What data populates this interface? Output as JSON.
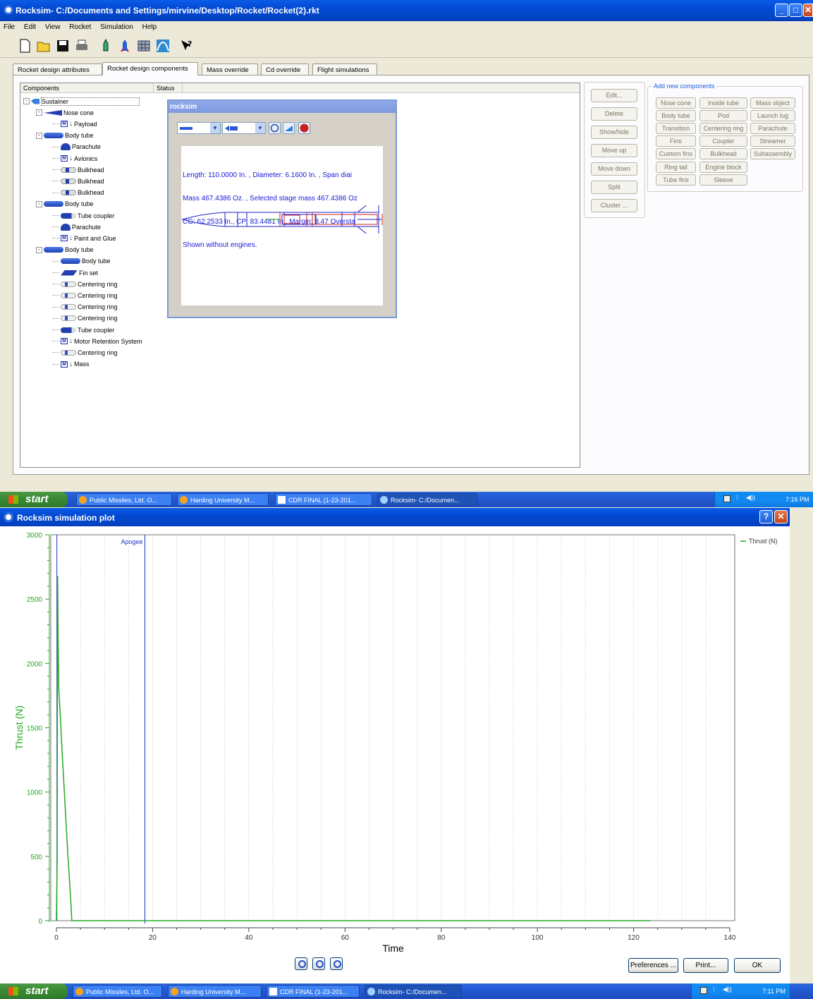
{
  "window_main": {
    "title": "Rocksim- C:/Documents and Settings/mirvine/Desktop/Rocket/Rocket(2).rkt",
    "menu": [
      "File",
      "Edit",
      "View",
      "Rocket",
      "Simulation",
      "Help"
    ],
    "tabs": [
      "Rocket design attributes",
      "Rocket design components",
      "Mass override",
      "Cd override",
      "Flight simulations"
    ],
    "active_tab": 1,
    "tree_header": {
      "components": "Components",
      "status": "Status"
    },
    "tree": [
      {
        "label": "Sustainer",
        "icon": "stage-icon",
        "level": 0,
        "expander": "-"
      },
      {
        "label": "Nose cone",
        "icon": "nose-cone-icon",
        "level": 1,
        "expander": "-"
      },
      {
        "label": "Payload",
        "icon": "mass-object-icon",
        "level": 2
      },
      {
        "label": "Body tube",
        "icon": "body-tube-icon",
        "level": 1,
        "expander": "-"
      },
      {
        "label": "Parachute",
        "icon": "parachute-icon",
        "level": 2
      },
      {
        "label": "Avionics",
        "icon": "mass-object-icon",
        "level": 2
      },
      {
        "label": "Bulkhead",
        "icon": "bulkhead-icon",
        "level": 2
      },
      {
        "label": "Bulkhead",
        "icon": "bulkhead-icon",
        "level": 2
      },
      {
        "label": "Bulkhead",
        "icon": "bulkhead-icon",
        "level": 2
      },
      {
        "label": "Body tube",
        "icon": "body-tube-icon",
        "level": 1,
        "expander": "-"
      },
      {
        "label": "Tube coupler",
        "icon": "tube-coupler-icon",
        "level": 2
      },
      {
        "label": "Parachute",
        "icon": "parachute-icon",
        "level": 2
      },
      {
        "label": "Paint and Glue",
        "icon": "mass-object-icon",
        "level": 2
      },
      {
        "label": "Body tube",
        "icon": "body-tube-icon",
        "level": 1,
        "expander": "-"
      },
      {
        "label": "Body tube",
        "icon": "body-tube-icon",
        "level": 2
      },
      {
        "label": "Fin set",
        "icon": "fin-set-icon",
        "level": 2
      },
      {
        "label": "Centering ring",
        "icon": "centering-ring-icon",
        "level": 2
      },
      {
        "label": "Centering ring",
        "icon": "centering-ring-icon",
        "level": 2
      },
      {
        "label": "Centering ring",
        "icon": "centering-ring-icon",
        "level": 2
      },
      {
        "label": "Centering ring",
        "icon": "centering-ring-icon",
        "level": 2
      },
      {
        "label": "Tube coupler",
        "icon": "tube-coupler-icon",
        "level": 2
      },
      {
        "label": "Motor Retention System",
        "icon": "mass-object-icon",
        "level": 2
      },
      {
        "label": "Centering ring",
        "icon": "centering-ring-icon",
        "level": 2
      },
      {
        "label": "Mass",
        "icon": "mass-object-icon",
        "level": 2
      }
    ],
    "rocksim_panel": {
      "title": "rocksim",
      "info_lines": [
        "Length: 110.0000 In. , Diameter: 6.1600 In. , Span diai",
        "Mass 467.4386 Oz. , Selected stage mass 467.4386 Oz",
        "CG: 62.2533 In., CP: 83.4481 In., Margin: 3.47 Oversta",
        "Shown without engines."
      ]
    },
    "action_buttons": [
      "Edit...",
      "Delete",
      "Show/hide",
      "Move up",
      "Move down",
      "Split",
      "Cluster ..."
    ],
    "add_components": {
      "legend": "Add new components",
      "buttons": [
        [
          "Nose cone",
          "Inside tube",
          "Mass object"
        ],
        [
          "Body tube",
          "Pod",
          "Launch lug"
        ],
        [
          "Transition",
          "Centering ring",
          "Parachute"
        ],
        [
          "Fins",
          "Coupler",
          "Streamer"
        ],
        [
          "Custom fins",
          "Bulkhead",
          "Subassembly"
        ],
        [
          "Ring tail",
          "Engine block"
        ],
        [
          "Tube fins",
          "Sleeve"
        ]
      ]
    }
  },
  "taskbar_top": {
    "start": "start",
    "tasks": [
      "Public Missiles, Ltd. O...",
      "Harding University M...",
      "CDR FINAL (1-23-201...",
      "Rocksim- C:/Documen..."
    ],
    "time": "7:16 PM"
  },
  "window_plot": {
    "title": "Rocksim simulation plot",
    "buttons": {
      "preferences": "Preferences ...",
      "print": "Print...",
      "ok": "OK"
    }
  },
  "chart_data": {
    "type": "line",
    "title": "",
    "xlabel": "Time",
    "ylabel": "Thrust (N)",
    "xlim": [
      0,
      140
    ],
    "ylim": [
      0,
      3000
    ],
    "x_ticks": [
      0,
      20,
      40,
      60,
      80,
      100,
      120,
      140
    ],
    "y_ticks": [
      0,
      500,
      1000,
      1500,
      2000,
      2500,
      3000
    ],
    "grid": true,
    "legend": "top-right",
    "series": [
      {
        "name": "Thrust (N)",
        "color": "#22aa22",
        "x": [
          0.0,
          0.15,
          0.25,
          0.35,
          0.5,
          0.8,
          1.2,
          1.8,
          2.4,
          3.0,
          3.2,
          123.5
        ],
        "y": [
          0,
          450,
          2680,
          2200,
          1800,
          1600,
          1300,
          900,
          500,
          150,
          0,
          0
        ]
      }
    ],
    "annotations": [
      {
        "label": "Apogee",
        "x": 18.4,
        "color": "#2030c0"
      }
    ]
  },
  "taskbar_bottom": {
    "start": "start",
    "tasks": [
      "Public Missiles, Ltd. O...",
      "Harding University M...",
      "CDR FINAL (1-23-201...",
      "Rocksim- C:/Documen..."
    ],
    "time": "7:11 PM"
  },
  "colors": {
    "xp_blue": "#0a5ce8",
    "plot_green": "#22aa22",
    "info_blue": "#1a1ad8"
  }
}
